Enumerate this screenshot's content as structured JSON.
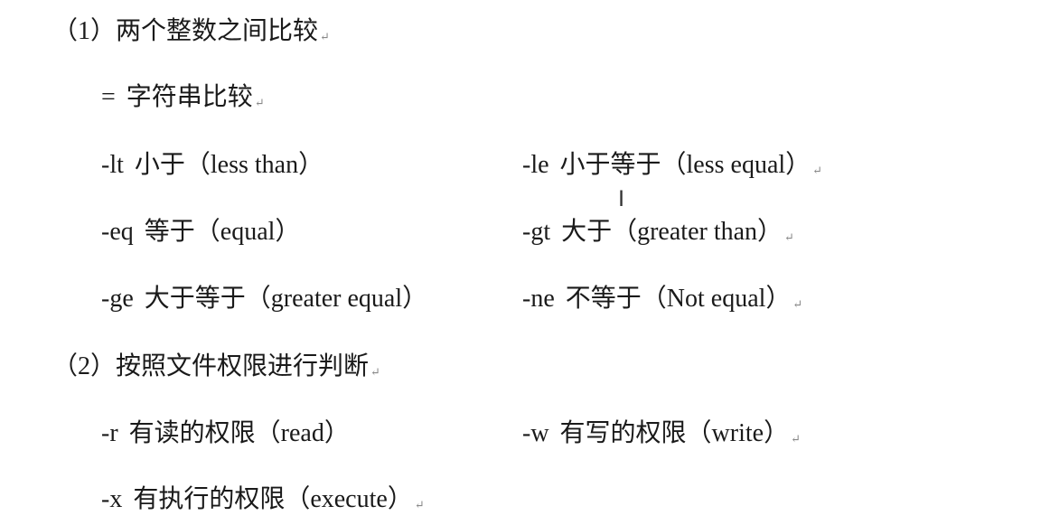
{
  "mark": "↵",
  "sections": [
    {
      "heading": "（1）两个整数之间比较"
    },
    {
      "heading": "（2）按照文件权限进行判断"
    }
  ],
  "string_compare": {
    "op": "=",
    "desc": "字符串比较"
  },
  "integer_ops": [
    {
      "op": "-lt",
      "desc": "小于（less than）"
    },
    {
      "op": "-le",
      "desc": "小于等于（less equal）"
    },
    {
      "op": "-eq",
      "desc": "等于（equal）"
    },
    {
      "op": "-gt",
      "desc": "大于（greater than）"
    },
    {
      "op": "-ge",
      "desc": "大于等于（greater equal）"
    },
    {
      "op": "-ne",
      "desc": "不等于（Not equal）"
    }
  ],
  "file_ops": [
    {
      "op": "-r",
      "desc": "有读的权限（read）"
    },
    {
      "op": "-w",
      "desc": "有写的权限（write）"
    },
    {
      "op": "-x",
      "desc": "有执行的权限（execute）"
    }
  ],
  "cursor_glyph": "I"
}
